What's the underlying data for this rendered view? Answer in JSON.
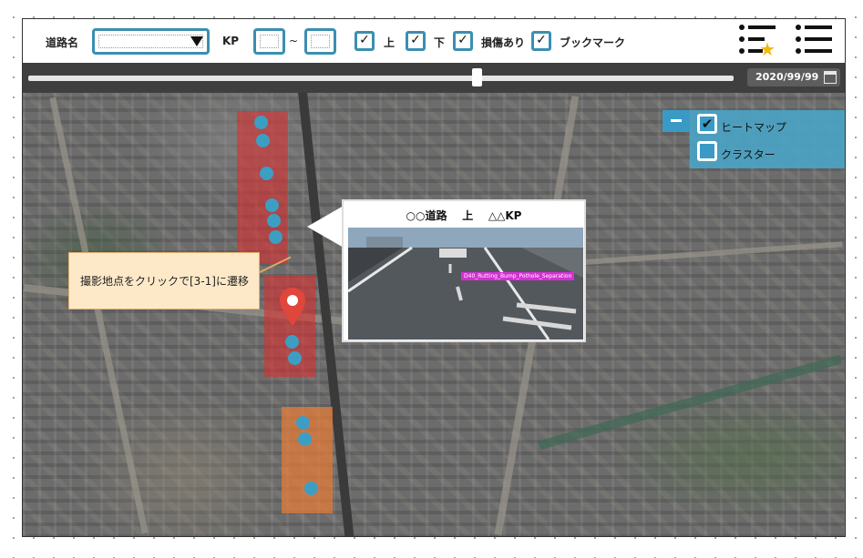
{
  "toolbar": {
    "road_name_label": "道路名",
    "road_name_value": "",
    "kp_label": "KP",
    "kp_from_value": "",
    "kp_separator": "~",
    "kp_to_value": "",
    "filters": [
      {
        "label": "上",
        "checked": true
      },
      {
        "label": "下",
        "checked": true
      },
      {
        "label": "損傷あり",
        "checked": true
      },
      {
        "label": "ブックマーク",
        "checked": true
      }
    ],
    "check_mark": "✓",
    "bookmark_menu_icon": "list-star-icon",
    "menu_icon": "list-icon"
  },
  "timeline": {
    "date": "2020/99/99",
    "position": 0.636,
    "calendar_icon": "calendar-icon"
  },
  "layers": {
    "items": [
      {
        "label": "ヒートマップ",
        "checked": true
      },
      {
        "label": "クラスター",
        "checked": false
      }
    ],
    "check_mark": "✔"
  },
  "popup": {
    "road": "○○道路",
    "direction": "上",
    "kp": "△△KP",
    "detection_tag": "D40_Rutting_Bump_Pothole_Separation"
  },
  "note": {
    "text": "撮影地点をクリックで[3-1]に遷移"
  },
  "colors": {
    "accent": "#3a8fb0",
    "heat_red": "#d63030",
    "heat_orange": "#e87d37",
    "point": "#3d9ec4",
    "pin": "#e0463c",
    "star": "#f2b705",
    "tag": "#d62fd6"
  }
}
